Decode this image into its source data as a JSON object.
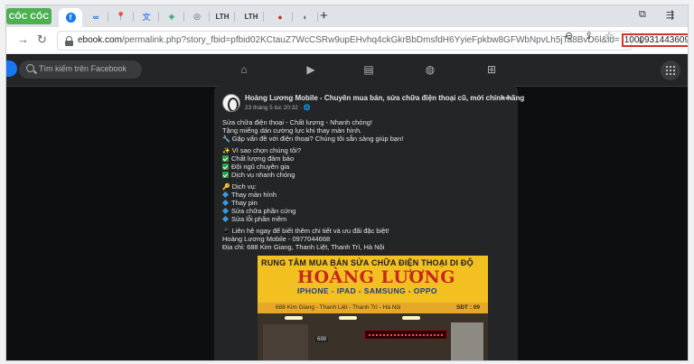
{
  "browser": {
    "brand": "CỐC CỐC",
    "tabs": [
      {
        "icon": "facebook-icon",
        "label": "f",
        "active": true
      },
      {
        "icon": "meta-icon",
        "label": "∞"
      },
      {
        "icon": "maps-pin-icon",
        "label": "📍"
      },
      {
        "icon": "translate-icon",
        "label": "文"
      },
      {
        "icon": "diamond-icon",
        "label": "◈"
      },
      {
        "icon": "globe-icon",
        "label": "◎"
      },
      {
        "icon": "lth-icon",
        "label": "LTH"
      },
      {
        "icon": "lth-icon",
        "label": "LTH"
      },
      {
        "icon": "mushroom-icon",
        "label": "●"
      },
      {
        "icon": "cocoa-icon",
        "label": "◐"
      }
    ],
    "new_tab": "+",
    "url_domain": "ebook.com",
    "url_path": "/permalink.php?story_fbid=pfbid02KCtauZ7WcCSRw9upEHvhq4ckGkrBbDmsfdH6YyieFpkbw8GFWbNpvLh5jTa8BvD6l&id=",
    "url_highlight": "100093144360985"
  },
  "facebook": {
    "search_placeholder": "Tìm kiếm trên Facebook"
  },
  "post": {
    "author": "Hoàng Lương Mobile - Chuyên mua bán, sửa chữa điện thoại cũ, mới chính hãng",
    "date": "23 tháng 5 lúc 20:32 · 🌐",
    "lines": {
      "l1": "Sửa chữa điện thoại - Chất lượng - Nhanh chóng!",
      "l2": "Tặng miếng dán cường lực khi thay màn hình.",
      "l3": "Gặp vấn đề với điện thoại? Chúng tôi sẵn sàng giúp bạn!",
      "l4": "Vì sao chọn chúng tôi?",
      "l5": "Chất lượng đảm bảo",
      "l6": "Đội ngũ chuyên gia",
      "l7": "Dịch vụ nhanh chóng",
      "l8": "Dịch vụ:",
      "l9": "Thay màn hình",
      "l10": "Thay pin",
      "l11": "Sửa chữa phần cứng",
      "l12": "Sửa lỗi phần mềm",
      "l13": "Liên hệ ngay để biết thêm chi tiết và ưu đãi đặc biệt!",
      "l14": "Hoàng Lương Mobile - 0977044668",
      "l15": "Địa chỉ: 688 Kim Giang, Thanh Liệt, Thanh Trì, Hà Nội"
    },
    "photo": {
      "line1": "RUNG TÂM MUA BÁN SỬA CHỮA ĐIỆN THOẠI DI ĐỘ",
      "shop_name": "HOÀNG LƯƠNG",
      "products": "IPHONE - IPAD - SAMSUNG - OPPO",
      "address": "688 Kim Giang - Thanh Liệt - Thanh Trì - Hà Nội",
      "phone_label": "SĐT : 09",
      "tag": "688"
    }
  }
}
